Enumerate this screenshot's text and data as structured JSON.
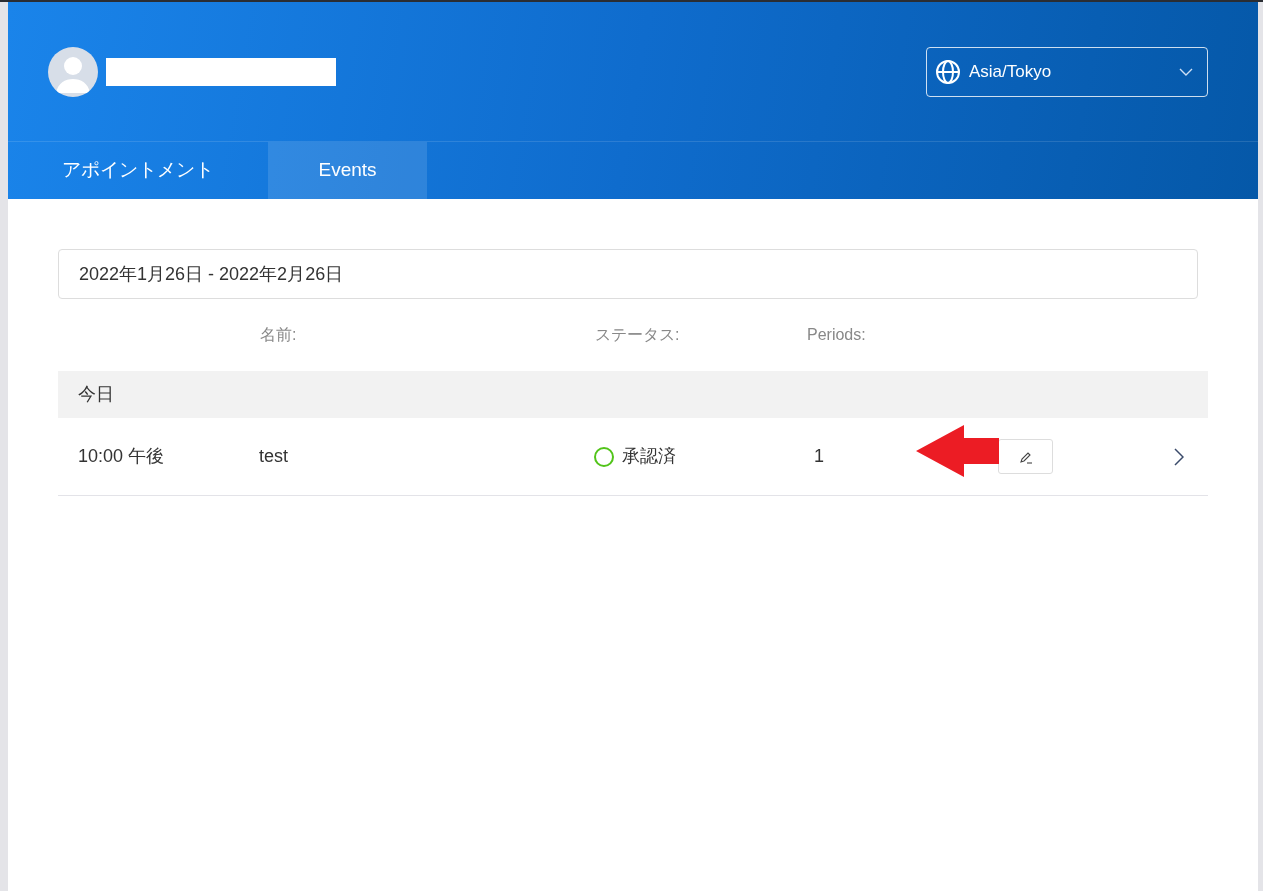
{
  "header": {
    "timezone": "Asia/Tokyo"
  },
  "tabs": [
    {
      "label": "アポイントメント",
      "selected": false
    },
    {
      "label": "Events",
      "selected": true
    }
  ],
  "date_range": "2022年1月26日 - 2022年2月26日",
  "table": {
    "columns": [
      "名前:",
      "ステータス:",
      "Periods:"
    ],
    "groups": [
      {
        "label": "今日",
        "rows": [
          {
            "time": "10:00 午後",
            "name": "test",
            "status": "承認済",
            "color": "#52c41a",
            "periods": "1"
          }
        ]
      }
    ]
  }
}
